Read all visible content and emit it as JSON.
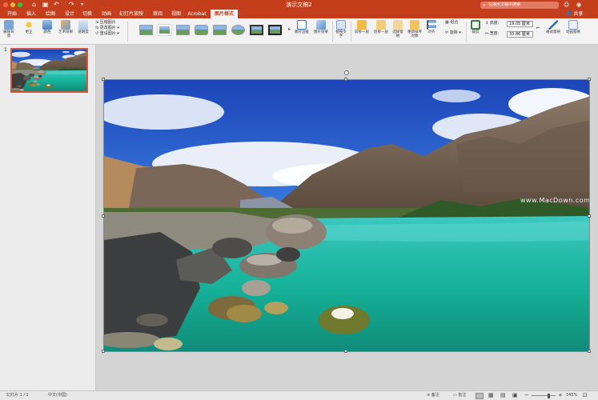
{
  "window": {
    "title": "演示文稿2",
    "search_placeholder": "在演示文稿中搜索"
  },
  "tabs": [
    "开始",
    "插入",
    "绘图",
    "设计",
    "切换",
    "动画",
    "幻灯片放映",
    "审阅",
    "视图",
    "Acrobat",
    "图片格式"
  ],
  "active_tab": "图片格式",
  "share_label": "共享",
  "ribbon": {
    "remove_bg": "删除背景",
    "corrections": "更正",
    "color": "颜色",
    "artistic": "艺术效果",
    "transparency": "透明度",
    "compress": "压缩图片",
    "change": "更改图片",
    "reset": "重设图片",
    "border": "图片边框",
    "effects": "图片效果",
    "alt_text": "替换文字",
    "forward": "前移一层",
    "backward": "后移一层",
    "selection_pane": "选择窗格",
    "reorder": "重新排序对象",
    "align": "对齐",
    "group": "组合",
    "rotate": "旋转",
    "crop": "裁剪",
    "height_label": "高度:",
    "height_value": "19.05 厘米",
    "width_label": "宽度:",
    "width_value": "33.86 厘米",
    "format_pane": "格式窗格",
    "animation_pane": "动画窗格"
  },
  "slides_panel": {
    "number": "1"
  },
  "image": {
    "watermark": "www.MacDown.com"
  },
  "status": {
    "slide": "幻灯片 1 / 1",
    "language": "中文(中国)",
    "notes": "备注",
    "comments": "批注",
    "zoom": "145%"
  }
}
